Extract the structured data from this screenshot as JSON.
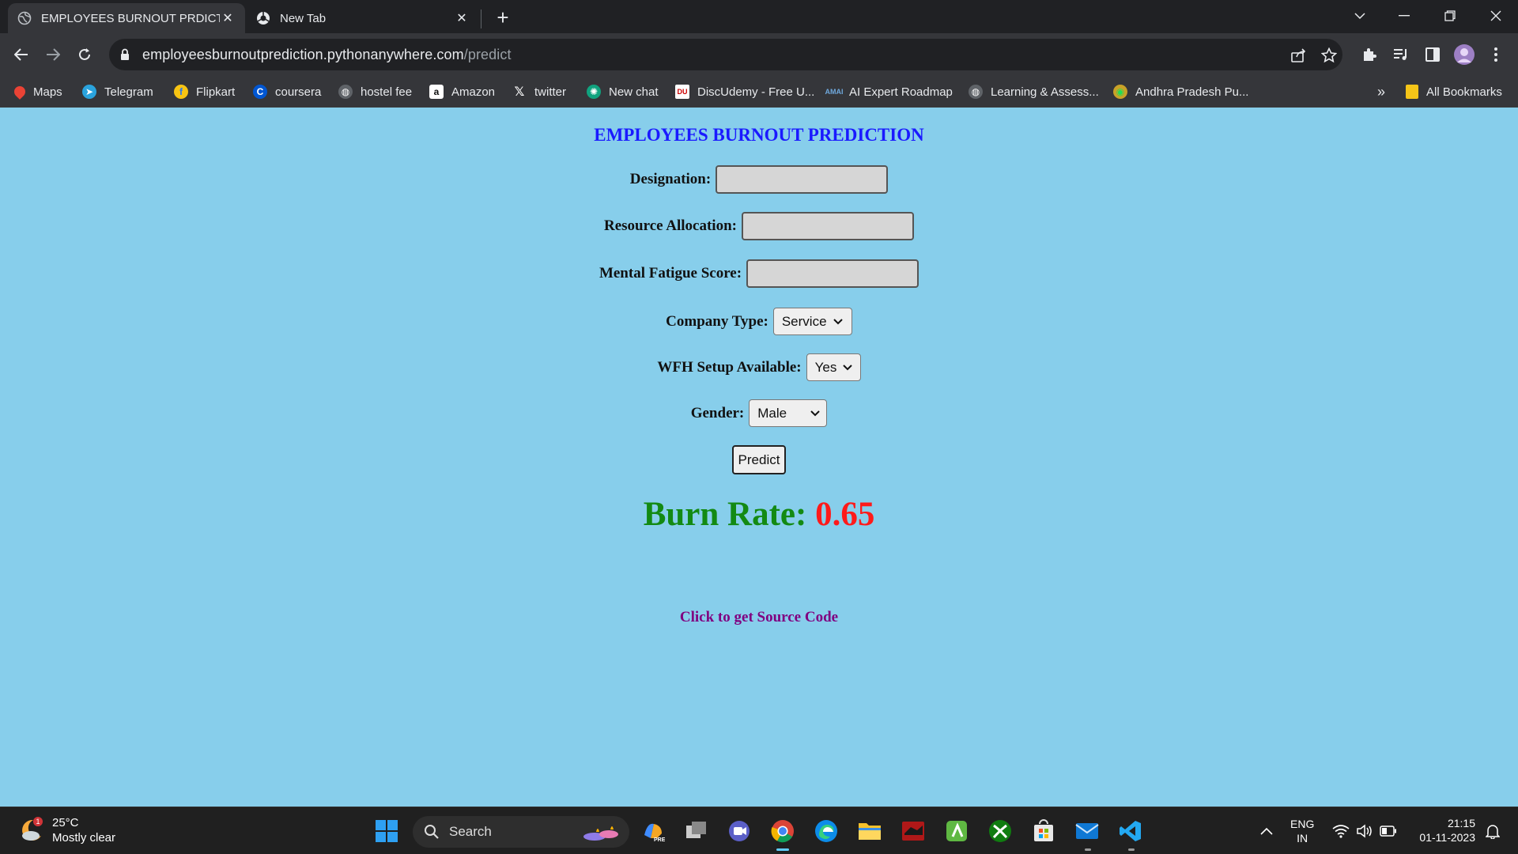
{
  "browser": {
    "tabs": [
      {
        "title": "EMPLOYEES BURNOUT PRDICTIO",
        "active": true
      },
      {
        "title": "New Tab",
        "active": false
      }
    ],
    "url_host": "employeesburnoutprediction.pythonanywhere.com",
    "url_path": "/predict",
    "bookmarks": [
      {
        "label": "Maps"
      },
      {
        "label": "Telegram"
      },
      {
        "label": "Flipkart"
      },
      {
        "label": "coursera"
      },
      {
        "label": "hostel fee"
      },
      {
        "label": "Amazon"
      },
      {
        "label": "twitter"
      },
      {
        "label": "New chat"
      },
      {
        "label": "DiscUdemy - Free U..."
      },
      {
        "label": "AI Expert Roadmap"
      },
      {
        "label": "Learning & Assess..."
      },
      {
        "label": "Andhra Pradesh Pu..."
      }
    ],
    "overflow_label": "»",
    "all_bookmarks": "All Bookmarks"
  },
  "page": {
    "heading": "EMPLOYEES BURNOUT PREDICTION",
    "fields": {
      "designation": {
        "label": "Designation:",
        "value": ""
      },
      "resource_allocation": {
        "label": "Resource Allocation:",
        "value": ""
      },
      "mental_fatigue": {
        "label": "Mental Fatigue Score:",
        "value": ""
      },
      "company_type": {
        "label": "Company Type:",
        "selected": "Service"
      },
      "wfh_setup": {
        "label": "WFH Setup Available:",
        "selected": "Yes"
      },
      "gender": {
        "label": "Gender:",
        "selected": "Male"
      }
    },
    "predict_label": "Predict",
    "result_label": "Burn Rate:",
    "result_value": "0.65",
    "source_link": "Click to get Source Code"
  },
  "taskbar": {
    "weather_temp": "25°C",
    "weather_desc": "Mostly clear",
    "weather_badge": "1",
    "search_placeholder": "Search",
    "lang_top": "ENG",
    "lang_bottom": "IN",
    "time": "21:15",
    "date": "01-11-2023"
  },
  "colors": {
    "page_bg": "#87ceeb",
    "heading": "#1a1aff",
    "burn_label": "#138a13",
    "burn_value": "#ff1a1a",
    "link": "#800080"
  }
}
